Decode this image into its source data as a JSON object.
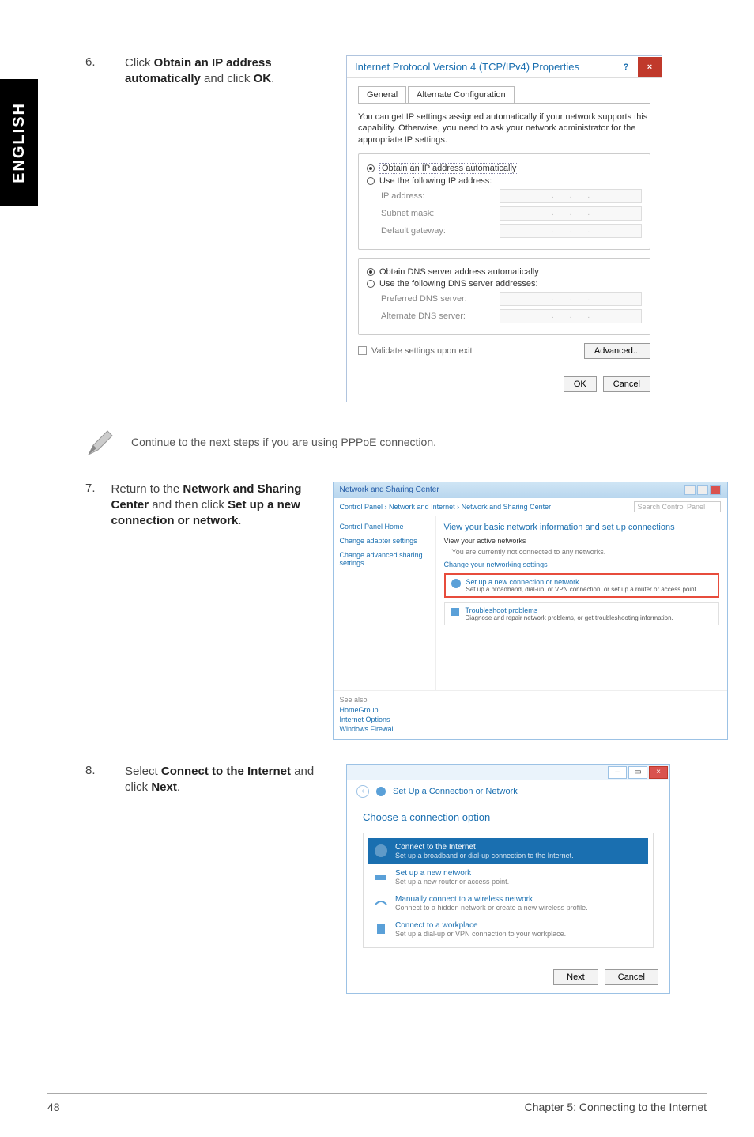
{
  "side_tab": "ENGLISH",
  "steps": {
    "s6": {
      "num": "6.",
      "text_pre": "Click ",
      "bold1": "Obtain an IP address automatically",
      "mid": " and click ",
      "bold2": "OK",
      "post": "."
    },
    "s7": {
      "num": "7.",
      "text_pre": "Return to the ",
      "bold1": "Network and Sharing Center",
      "mid1": " and then click ",
      "bold2": "Set up a new connection or network",
      "post": "."
    },
    "s8": {
      "num": "8.",
      "text_pre": "Select ",
      "bold1": "Connect to the Internet",
      "mid": " and click ",
      "bold2": "Next",
      "post": "."
    }
  },
  "note": "Continue to the next steps if you are using PPPoE connection.",
  "ipv4": {
    "title": "Internet Protocol Version 4 (TCP/IPv4) Properties",
    "help": "?",
    "close": "×",
    "tab_general": "General",
    "tab_alt": "Alternate Configuration",
    "desc": "You can get IP settings assigned automatically if your network supports this capability. Otherwise, you need to ask your network administrator for the appropriate IP settings.",
    "r_auto_ip": "Obtain an IP address automatically",
    "r_use_ip": "Use the following IP address:",
    "f_ip": "IP address:",
    "f_subnet": "Subnet mask:",
    "f_gateway": "Default gateway:",
    "r_auto_dns": "Obtain DNS server address automatically",
    "r_use_dns": "Use the following DNS server addresses:",
    "f_pref_dns": "Preferred DNS server:",
    "f_alt_dns": "Alternate DNS server:",
    "validate": "Validate settings upon exit",
    "advanced": "Advanced...",
    "ok": "OK",
    "cancel": "Cancel"
  },
  "nsc": {
    "wintitle": "Network and Sharing Center",
    "breadcrumb": "Control Panel  ›  Network and Internet  ›  Network and Sharing Center",
    "search_placeholder": "Search Control Panel",
    "side_home": "Control Panel Home",
    "side_adapter": "Change adapter settings",
    "side_advshare": "Change advanced sharing settings",
    "h1": "View your basic network information and set up connections",
    "active": "View your active networks",
    "not_connected": "You are currently not connected to any networks.",
    "change": "Change your networking settings",
    "item1_title": "Set up a new connection or network",
    "item1_desc": "Set up a broadband, dial-up, or VPN connection; or set up a router or access point.",
    "item2_title": "Troubleshoot problems",
    "item2_desc": "Diagnose and repair network problems, or get troubleshooting information.",
    "seealso": "See also",
    "sa1": "HomeGroup",
    "sa2": "Internet Options",
    "sa3": "Windows Firewall"
  },
  "wiz": {
    "head": "Set Up a Connection or Network",
    "title": "Choose a connection option",
    "opt1_t": "Connect to the Internet",
    "opt1_d": "Set up a broadband or dial-up connection to the Internet.",
    "opt2_t": "Set up a new network",
    "opt2_d": "Set up a new router or access point.",
    "opt3_t": "Manually connect to a wireless network",
    "opt3_d": "Connect to a hidden network or create a new wireless profile.",
    "opt4_t": "Connect to a workplace",
    "opt4_d": "Set up a dial-up or VPN connection to your workplace.",
    "next": "Next",
    "cancel": "Cancel"
  },
  "footer": {
    "page": "48",
    "chapter": "Chapter 5: Connecting to the Internet"
  }
}
